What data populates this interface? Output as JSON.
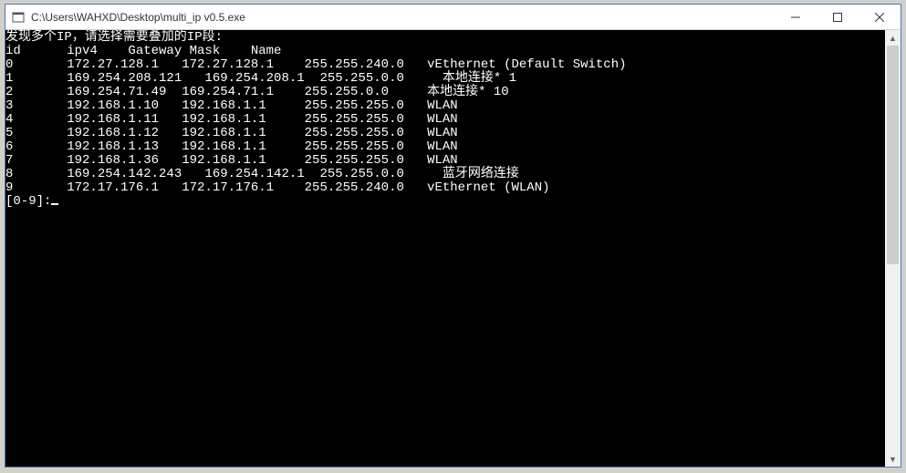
{
  "window": {
    "title": "C:\\Users\\WAHXD\\Desktop\\multi_ip v0.5.exe"
  },
  "console": {
    "intro": "发现多个IP，请选择需要叠加的IP段:",
    "header": "id      ipv4    Gateway Mask    Name",
    "rows": [
      {
        "id": "0",
        "ip": "172.27.128.1",
        "gw": "172.27.128.1",
        "mask": "255.255.240.0",
        "name": "vEthernet (Default Switch)"
      },
      {
        "id": "1",
        "ip": "169.254.208.121",
        "gw": "169.254.208.1",
        "mask": "255.255.0.0",
        "name": "本地连接* 1"
      },
      {
        "id": "2",
        "ip": "169.254.71.49",
        "gw": "169.254.71.1",
        "mask": "255.255.0.0",
        "name": "本地连接* 10"
      },
      {
        "id": "3",
        "ip": "192.168.1.10",
        "gw": "192.168.1.1",
        "mask": "255.255.255.0",
        "name": "WLAN"
      },
      {
        "id": "4",
        "ip": "192.168.1.11",
        "gw": "192.168.1.1",
        "mask": "255.255.255.0",
        "name": "WLAN"
      },
      {
        "id": "5",
        "ip": "192.168.1.12",
        "gw": "192.168.1.1",
        "mask": "255.255.255.0",
        "name": "WLAN"
      },
      {
        "id": "6",
        "ip": "192.168.1.13",
        "gw": "192.168.1.1",
        "mask": "255.255.255.0",
        "name": "WLAN"
      },
      {
        "id": "7",
        "ip": "192.168.1.36",
        "gw": "192.168.1.1",
        "mask": "255.255.255.0",
        "name": "WLAN"
      },
      {
        "id": "8",
        "ip": "169.254.142.243",
        "gw": "169.254.142.1",
        "mask": "255.255.0.0",
        "name": "蓝牙网络连接"
      },
      {
        "id": "9",
        "ip": "172.17.176.1",
        "gw": "172.17.176.1",
        "mask": "255.255.240.0",
        "name": "vEthernet (WLAN)"
      }
    ],
    "prompt": "[0-9]:"
  }
}
